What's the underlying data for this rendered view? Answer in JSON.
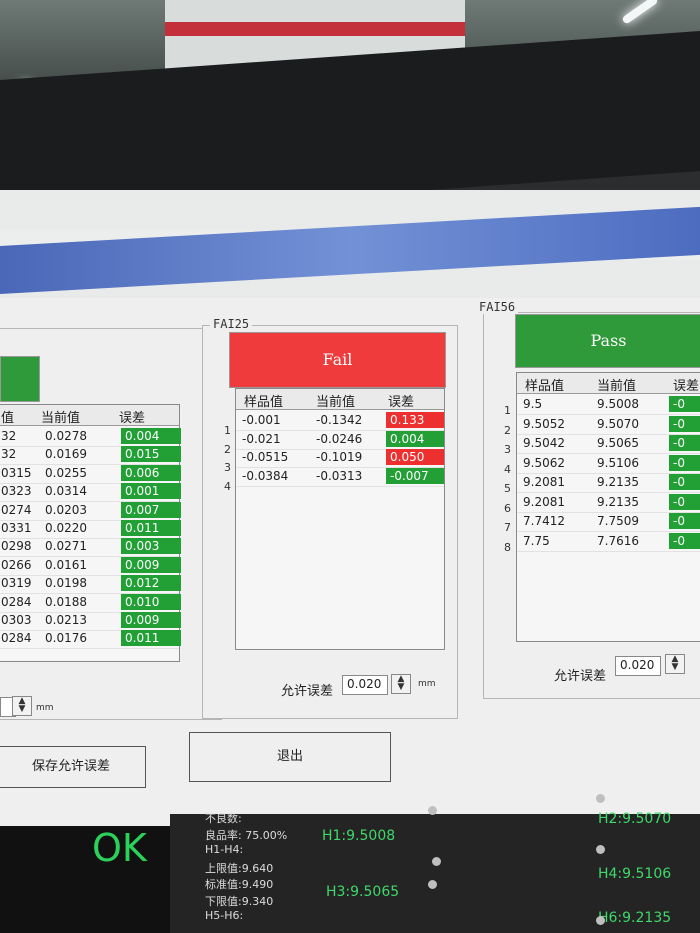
{
  "left_panel": {
    "header": [
      "值",
      "当前值",
      "误差"
    ],
    "rows": [
      {
        "s": "32",
        "c": "0.0278",
        "e": "0.004",
        "st": "ok"
      },
      {
        "s": "32",
        "c": "0.0169",
        "e": "0.015",
        "st": "ok"
      },
      {
        "s": "0315",
        "c": "0.0255",
        "e": "0.006",
        "st": "ok"
      },
      {
        "s": "0323",
        "c": "0.0314",
        "e": "0.001",
        "st": "ok"
      },
      {
        "s": "0274",
        "c": "0.0203",
        "e": "0.007",
        "st": "ok"
      },
      {
        "s": "0331",
        "c": "0.0220",
        "e": "0.011",
        "st": "ok"
      },
      {
        "s": "0298",
        "c": "0.0271",
        "e": "0.003",
        "st": "ok"
      },
      {
        "s": "0266",
        "c": "0.0161",
        "e": "0.009",
        "st": "ok"
      },
      {
        "s": "0319",
        "c": "0.0198",
        "e": "0.012",
        "st": "ok"
      },
      {
        "s": "0284",
        "c": "0.0188",
        "e": "0.010",
        "st": "ok"
      },
      {
        "s": "0303",
        "c": "0.0213",
        "e": "0.009",
        "st": "ok"
      },
      {
        "s": "0284",
        "c": "0.0176",
        "e": "0.011",
        "st": "ok"
      }
    ],
    "unit": "mm",
    "save_button": "保存允许误差"
  },
  "fai25": {
    "label": "FAI25",
    "status": "Fail",
    "header": [
      "样品值",
      "当前值",
      "误差"
    ],
    "rows": [
      {
        "n": "1",
        "s": "-0.001",
        "c": "-0.1342",
        "e": "0.133",
        "st": "ng"
      },
      {
        "n": "2",
        "s": "-0.021",
        "c": "-0.0246",
        "e": "0.004",
        "st": "ok"
      },
      {
        "n": "3",
        "s": "-0.0515",
        "c": "-0.1019",
        "e": "0.050",
        "st": "ng"
      },
      {
        "n": "4",
        "s": "-0.0384",
        "c": "-0.0313",
        "e": "-0.007",
        "st": "ok"
      }
    ],
    "tolerance_label": "允许误差",
    "tolerance_value": "0.020",
    "unit": "mm"
  },
  "fai56": {
    "label": "FAI56",
    "status": "Pass",
    "header": [
      "样品值",
      "当前值",
      "误差"
    ],
    "rows": [
      {
        "n": "1",
        "s": "9.5",
        "c": "9.5008",
        "e": "-0",
        "st": "ok"
      },
      {
        "n": "2",
        "s": "9.5052",
        "c": "9.5070",
        "e": "-0",
        "st": "ok"
      },
      {
        "n": "3",
        "s": "9.5042",
        "c": "9.5065",
        "e": "-0",
        "st": "ok"
      },
      {
        "n": "4",
        "s": "9.5062",
        "c": "9.5106",
        "e": "-0",
        "st": "ok"
      },
      {
        "n": "5",
        "s": "9.2081",
        "c": "9.2135",
        "e": "-0",
        "st": "ok"
      },
      {
        "n": "6",
        "s": "9.2081",
        "c": "9.2135",
        "e": "-0",
        "st": "ok"
      },
      {
        "n": "7",
        "s": "7.7412",
        "c": "7.7509",
        "e": "-0",
        "st": "ok"
      },
      {
        "n": "8",
        "s": "7.75",
        "c": "7.7616",
        "e": "-0",
        "st": "ok"
      }
    ],
    "tolerance_label": "允许误差",
    "tolerance_value": "0.020"
  },
  "exit_button": "退出",
  "bottom": {
    "ok_label": "OK",
    "side_text": [
      "不良数:",
      "良品率: 75.00%",
      "H1-H4:",
      "上限值:9.640",
      "标准值:9.490",
      "下限值:9.340",
      "H5-H6:"
    ],
    "readings": [
      "H1:9.5008",
      "H2:9.5070",
      "H3:9.5065",
      "H4:9.5106",
      "H6:9.2135"
    ]
  },
  "colors": {
    "ok": "#22a036",
    "ng": "#ee2f2f",
    "status_bar": "#4a67b8"
  }
}
